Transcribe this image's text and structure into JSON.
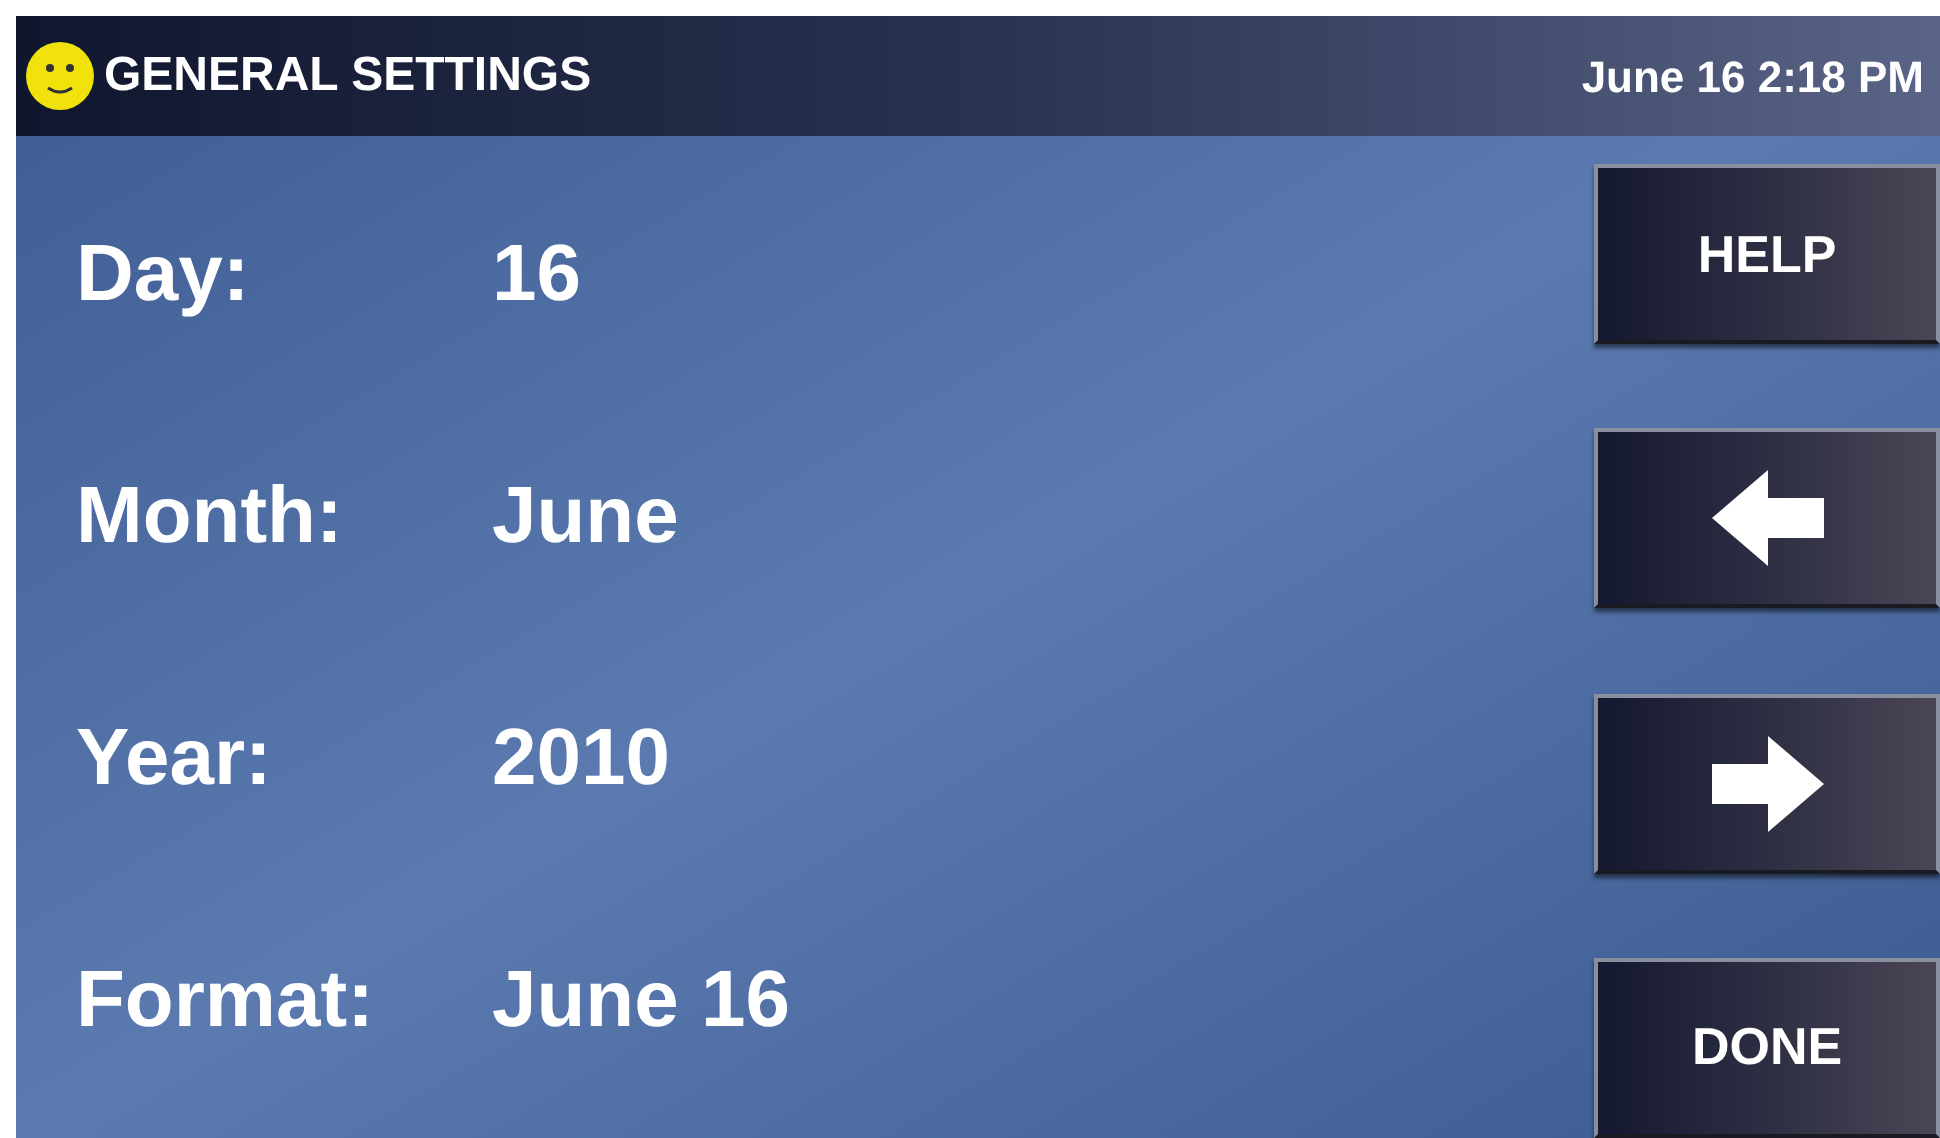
{
  "header": {
    "title": "GENERAL SETTINGS",
    "datetime": "June 16 2:18 PM"
  },
  "fields": [
    {
      "label": "Day:",
      "value": "16"
    },
    {
      "label": "Month:",
      "value": "June"
    },
    {
      "label": "Year:",
      "value": "2010"
    },
    {
      "label": "Format:",
      "value": "June 16"
    }
  ],
  "buttons": [
    {
      "kind": "text",
      "label": "HELP"
    },
    {
      "kind": "arrow_left"
    },
    {
      "kind": "arrow_right"
    },
    {
      "kind": "text",
      "label": "DONE"
    }
  ]
}
